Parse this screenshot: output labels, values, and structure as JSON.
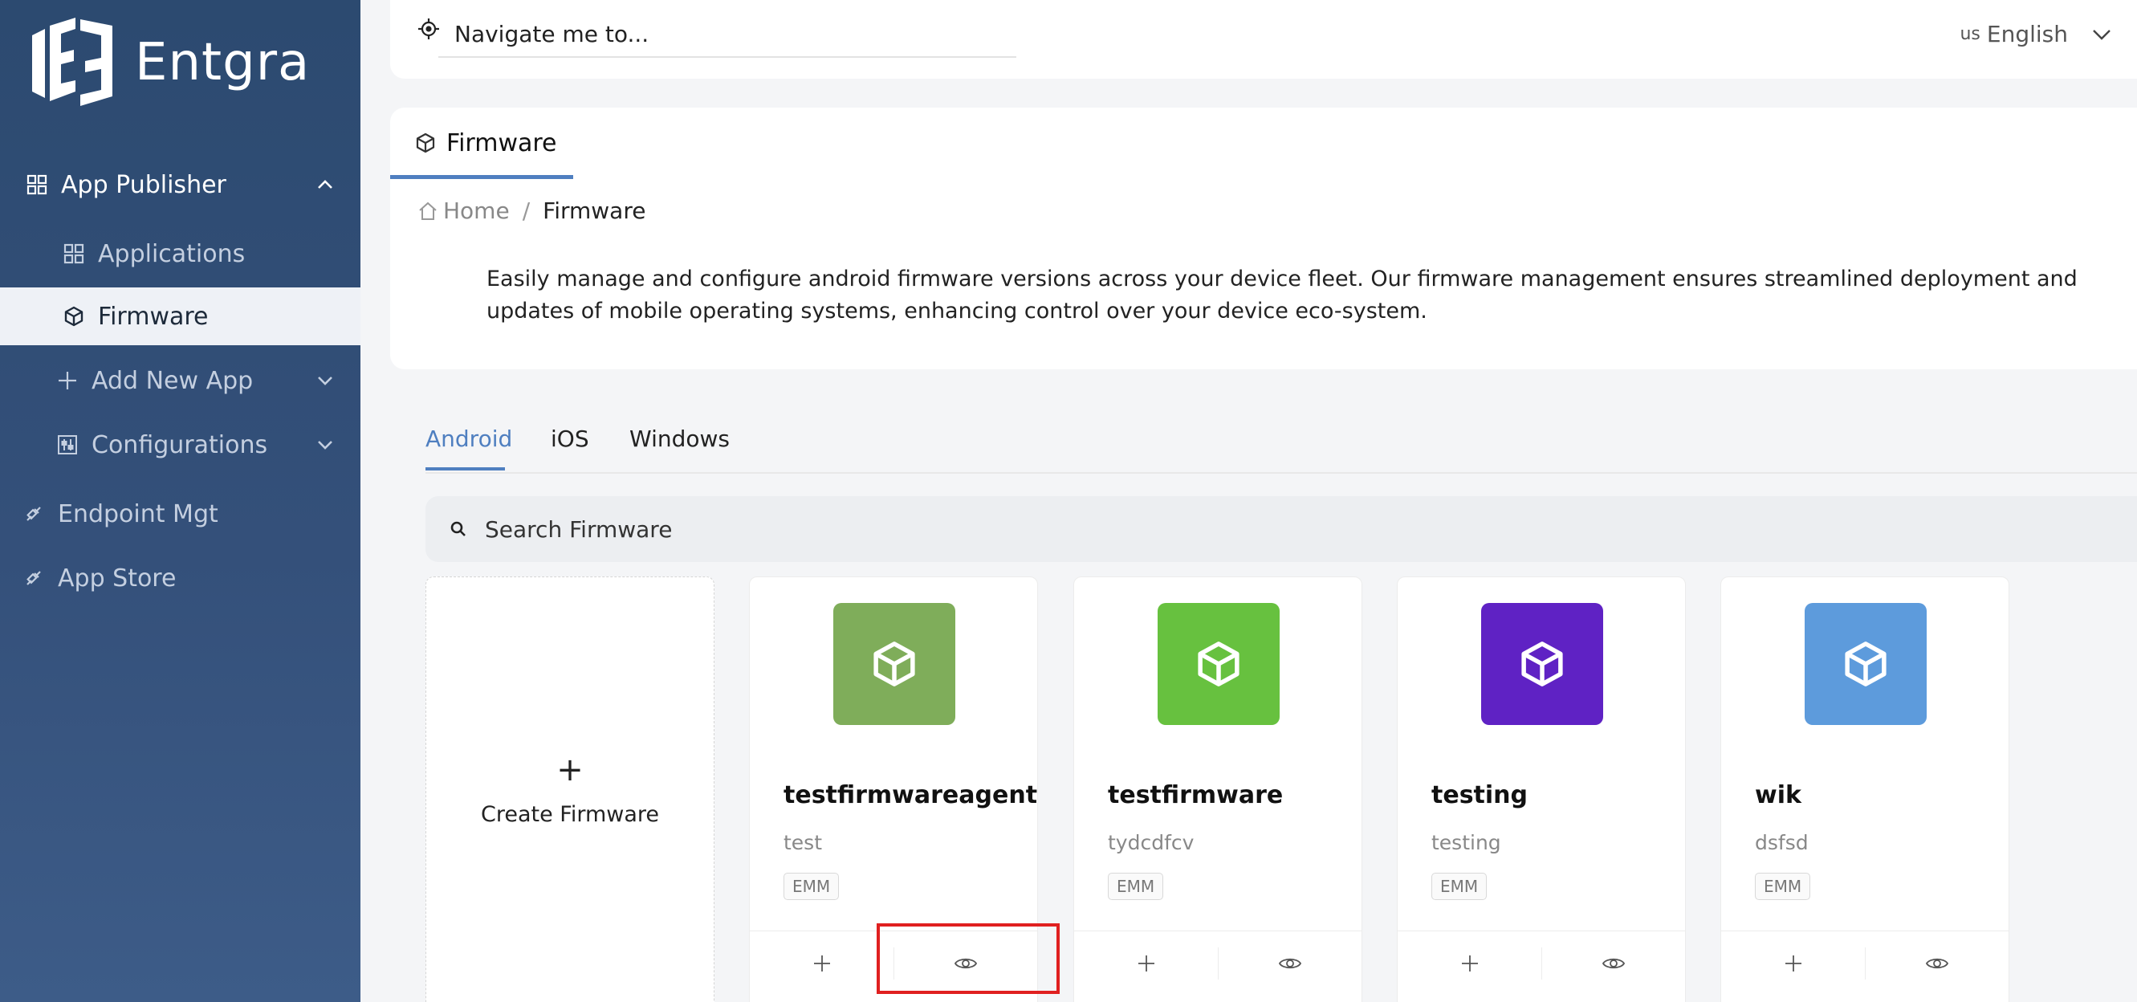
{
  "brand": {
    "name": "Entgra"
  },
  "sidebar": {
    "items": [
      {
        "label": "App Publisher",
        "icon": "grid-icon"
      },
      {
        "label": "Applications",
        "icon": "grid-icon"
      },
      {
        "label": "Firmware",
        "icon": "box-icon"
      },
      {
        "label": "Add New App",
        "icon": "plus-icon"
      },
      {
        "label": "Configurations",
        "icon": "sliders-icon"
      },
      {
        "label": "Endpoint Mgt",
        "icon": "link-icon"
      },
      {
        "label": "App Store",
        "icon": "link-icon"
      }
    ]
  },
  "topbar": {
    "nav_placeholder": "Navigate me to...",
    "lang_flag": "us",
    "lang_label": "English"
  },
  "page": {
    "tab_label": "Firmware",
    "breadcrumb": {
      "home": "Home",
      "sep": "/",
      "current": "Firmware"
    },
    "description": "Easily manage and configure android firmware versions across your device fleet. Our firmware management ensures streamlined deployment and updates of mobile operating systems, enhancing control over your device eco-system."
  },
  "platform_tabs": [
    "Android",
    "iOS",
    "Windows"
  ],
  "search": {
    "placeholder": "Search Firmware"
  },
  "create_card": {
    "plus": "+",
    "label": "Create Firmware"
  },
  "cards": [
    {
      "name": "testfirmwareagent",
      "desc": "test",
      "badge": "EMM",
      "color": "#7fad5a"
    },
    {
      "name": "testfirmware",
      "desc": "tydcdfcv",
      "badge": "EMM",
      "color": "#67c13f"
    },
    {
      "name": "testing",
      "desc": "testing",
      "badge": "EMM",
      "color": "#5f22c4"
    },
    {
      "name": "wik",
      "desc": "dsfsd",
      "badge": "EMM",
      "color": "#5d9bdc"
    }
  ],
  "colors": {
    "accent": "#4f7fc0",
    "sidebar": "#2c4a70",
    "highlight": "#e02020"
  }
}
